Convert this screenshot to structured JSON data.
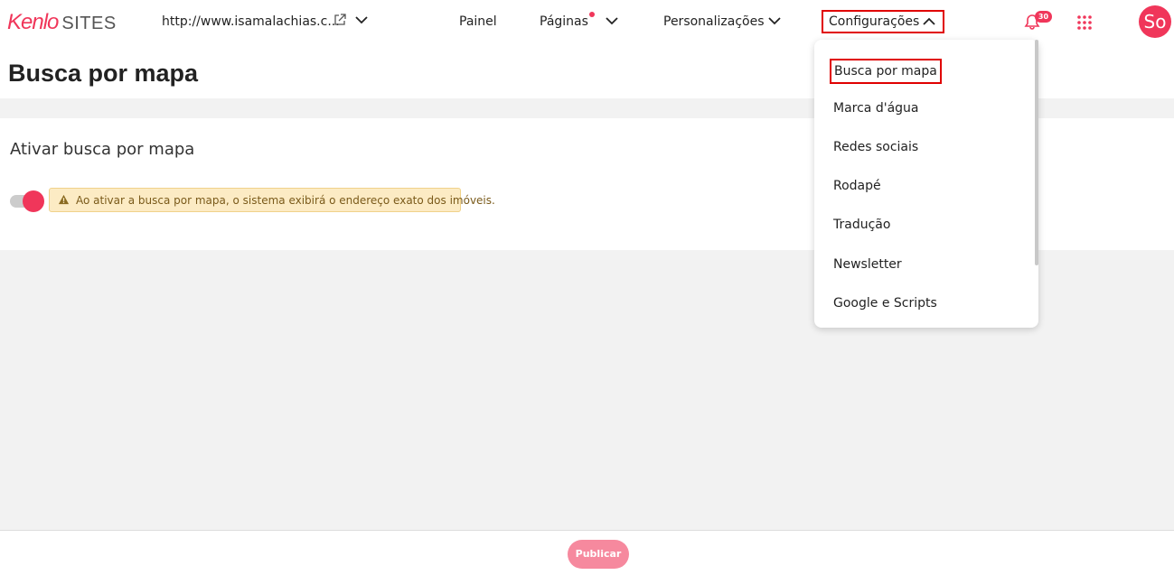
{
  "brand": {
    "logo_main": "Kenlo",
    "logo_sub": "SITES",
    "accent": "#f0365a"
  },
  "site": {
    "url": "http://www.isamalachias.c..."
  },
  "nav": {
    "painel": "Painel",
    "paginas": "Páginas",
    "personalizacoes": "Personalizações",
    "configuracoes": "Configurações"
  },
  "notifications": {
    "count": "30"
  },
  "user": {
    "avatar_initials": "So"
  },
  "page": {
    "title": "Busca por mapa"
  },
  "card": {
    "title": "Ativar busca por mapa",
    "toggle_on": true,
    "warning": "Ao ativar a busca por mapa, o sistema exibirá o endereço exato dos imóveis."
  },
  "dropdown": {
    "items": [
      {
        "label": "Busca por mapa",
        "active": true
      },
      {
        "label": "Marca d'água"
      },
      {
        "label": "Redes sociais"
      },
      {
        "label": "Rodapé"
      },
      {
        "label": "Tradução"
      },
      {
        "label": "Newsletter"
      },
      {
        "label": "Google e Scripts"
      }
    ]
  },
  "footer": {
    "publish_label": "Publicar"
  },
  "icons": {
    "external_link": "external-link-icon",
    "chevron_down": "chevron-down-icon",
    "chevron_up": "chevron-up-icon",
    "bell": "bell-icon",
    "apps": "apps-grid-icon",
    "warning": "warning-icon"
  }
}
